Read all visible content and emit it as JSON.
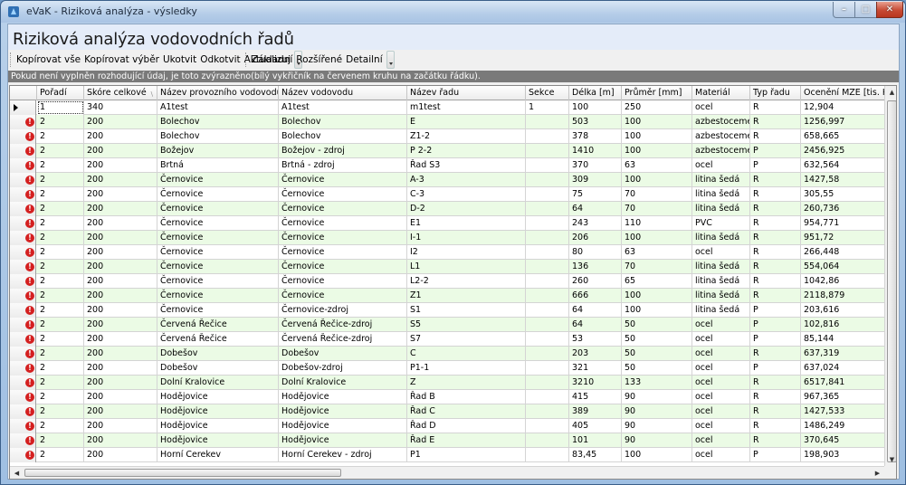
{
  "window": {
    "title": "eVaK - Riziková analýza - výsledky"
  },
  "page": {
    "title": "Riziková analýza vodovodních řadů"
  },
  "toolbar": {
    "group1": [
      "Kopírovat vše",
      "Kopírovat výběr",
      "Ukotvit",
      "Odkotvit",
      "Aktualizuj"
    ],
    "group2": [
      "Základní",
      "Rozšířené",
      "Detailní"
    ]
  },
  "info": "Pokud není vyplněn rozhodující údaj, je toto zvýrazněno(bílý vykřičník na červenem kruhu na začátku řádku).",
  "table": {
    "columns": [
      "Pořadí",
      "Skóre celkové",
      "Název provozního vodovodu",
      "Název vodovodu",
      "Název řadu",
      "Sekce",
      "Délka [m]",
      "Průměr [mm]",
      "Materiál",
      "Typ řadu",
      "Ocenění MZE [tis. Kč]"
    ],
    "rows": [
      [
        "1",
        "340",
        "A1test",
        "A1test",
        "m1test",
        "1",
        "100",
        "250",
        "ocel",
        "R",
        "12,904"
      ],
      [
        "2",
        "200",
        "Bolechov",
        "Bolechov",
        "E",
        "",
        "503",
        "100",
        "azbestocement",
        "R",
        "1256,997"
      ],
      [
        "2",
        "200",
        "Bolechov",
        "Bolechov",
        "Z1-2",
        "",
        "378",
        "100",
        "azbestocement",
        "R",
        "658,665"
      ],
      [
        "2",
        "200",
        "Božejov",
        "Božejov - zdroj",
        "P 2-2",
        "",
        "1410",
        "100",
        "azbestocement",
        "P",
        "2456,925"
      ],
      [
        "2",
        "200",
        "Brtná",
        "Brtná - zdroj",
        "Řad S3",
        "",
        "370",
        "63",
        "ocel",
        "P",
        "632,564"
      ],
      [
        "2",
        "200",
        "Černovice",
        "Černovice",
        "A-3",
        "",
        "309",
        "100",
        "litina šedá",
        "R",
        "1427,58"
      ],
      [
        "2",
        "200",
        "Černovice",
        "Černovice",
        "C-3",
        "",
        "75",
        "70",
        "litina šedá",
        "R",
        "305,55"
      ],
      [
        "2",
        "200",
        "Černovice",
        "Černovice",
        "D-2",
        "",
        "64",
        "70",
        "litina šedá",
        "R",
        "260,736"
      ],
      [
        "2",
        "200",
        "Černovice",
        "Černovice",
        "E1",
        "",
        "243",
        "110",
        "PVC",
        "R",
        "954,771"
      ],
      [
        "2",
        "200",
        "Černovice",
        "Černovice",
        "I-1",
        "",
        "206",
        "100",
        "litina šedá",
        "R",
        "951,72"
      ],
      [
        "2",
        "200",
        "Černovice",
        "Černovice",
        "I2",
        "",
        "80",
        "63",
        "ocel",
        "R",
        "266,448"
      ],
      [
        "2",
        "200",
        "Černovice",
        "Černovice",
        "L1",
        "",
        "136",
        "70",
        "litina šedá",
        "R",
        "554,064"
      ],
      [
        "2",
        "200",
        "Černovice",
        "Černovice",
        "L2-2",
        "",
        "260",
        "65",
        "litina šedá",
        "R",
        "1042,86"
      ],
      [
        "2",
        "200",
        "Černovice",
        "Černovice",
        "Z1",
        "",
        "666",
        "100",
        "litina šedá",
        "R",
        "2118,879"
      ],
      [
        "2",
        "200",
        "Černovice",
        "Černovice-zdroj",
        "S1",
        "",
        "64",
        "100",
        "litina šedá",
        "P",
        "203,616"
      ],
      [
        "2",
        "200",
        "Červená Řečice",
        "Červená Řečice-zdroj",
        "S5",
        "",
        "64",
        "50",
        "ocel",
        "P",
        "102,816"
      ],
      [
        "2",
        "200",
        "Červená Řečice",
        "Červená Řečice-zdroj",
        "S7",
        "",
        "53",
        "50",
        "ocel",
        "P",
        "85,144"
      ],
      [
        "2",
        "200",
        "Dobešov",
        "Dobešov",
        "C",
        "",
        "203",
        "50",
        "ocel",
        "R",
        "637,319"
      ],
      [
        "2",
        "200",
        "Dobešov",
        "Dobešov-zdroj",
        "P1-1",
        "",
        "321",
        "50",
        "ocel",
        "P",
        "637,024"
      ],
      [
        "2",
        "200",
        "Dolní Kralovice",
        "Dolní Kralovice",
        "Z",
        "",
        "3210",
        "133",
        "ocel",
        "R",
        "6517,841"
      ],
      [
        "2",
        "200",
        "Hodějovice",
        "Hodějovice",
        "Řad B",
        "",
        "415",
        "90",
        "ocel",
        "R",
        "967,365"
      ],
      [
        "2",
        "200",
        "Hodějovice",
        "Hodějovice",
        "Řad C",
        "",
        "389",
        "90",
        "ocel",
        "R",
        "1427,533"
      ],
      [
        "2",
        "200",
        "Hodějovice",
        "Hodějovice",
        "Řad D",
        "",
        "405",
        "90",
        "ocel",
        "R",
        "1486,249"
      ],
      [
        "2",
        "200",
        "Hodějovice",
        "Hodějovice",
        "Řad E",
        "",
        "101",
        "90",
        "ocel",
        "R",
        "370,645"
      ],
      [
        "2",
        "200",
        "Horní Cerekev",
        "Horní Cerekev - zdroj",
        "P1",
        "",
        "83,45",
        "100",
        "ocel",
        "P",
        "198,903"
      ]
    ]
  },
  "colors": {
    "row_alt": "#ebfbe5",
    "error_icon": "#d42020",
    "info_bar": "#7a7a7a"
  }
}
